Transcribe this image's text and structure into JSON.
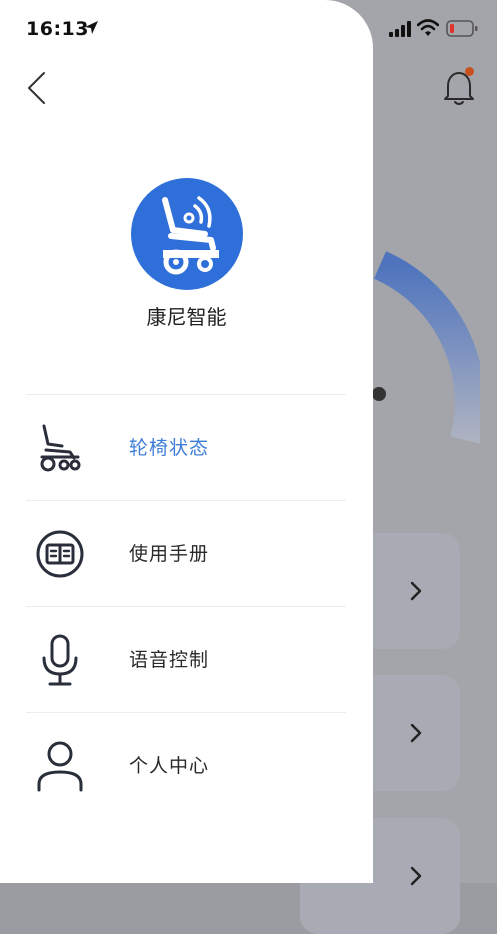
{
  "status_bar": {
    "time": "16:13"
  },
  "app": {
    "brand_name": "康尼智能"
  },
  "menu": {
    "items": [
      {
        "label": "轮椅状态",
        "icon": "wheelchair-icon",
        "active": true
      },
      {
        "label": "使用手册",
        "icon": "book-icon",
        "active": false
      },
      {
        "label": "语音控制",
        "icon": "microphone-icon",
        "active": false
      },
      {
        "label": "个人中心",
        "icon": "person-icon",
        "active": false
      }
    ]
  },
  "colors": {
    "accent": "#3e7ed9",
    "logo_bg": "#2f6fd9",
    "overlay": "#a3a5aa",
    "notification_dot": "#c8501f"
  }
}
